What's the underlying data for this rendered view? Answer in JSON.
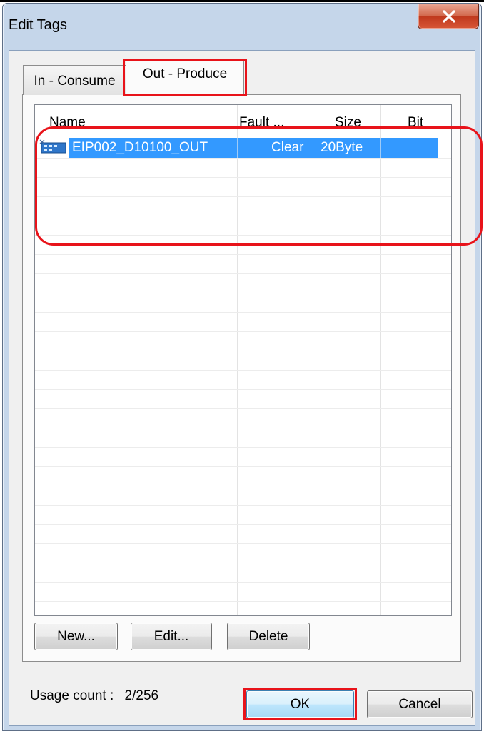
{
  "window": {
    "title": "Edit Tags",
    "close_glyph": "x"
  },
  "tabs": [
    {
      "label": "In - Consume",
      "active": false
    },
    {
      "label": "Out - Produce",
      "active": true
    }
  ],
  "list": {
    "columns": [
      "Name",
      "Fault ...",
      "Size",
      "Bit"
    ],
    "rows": [
      {
        "name": "EIP002_D10100_OUT",
        "fault": "Clear",
        "size": "20Byte",
        "bit": "",
        "selected": true,
        "icon": "tag-icon"
      }
    ]
  },
  "buttons": {
    "new": "New...",
    "edit": "Edit...",
    "delete": "Delete",
    "ok": "OK",
    "cancel": "Cancel"
  },
  "usage": {
    "label": "Usage count :",
    "value": "2/256"
  },
  "colors": {
    "selection": "#3399ff",
    "highlight": "#e8131a",
    "window_frame": "#c5d6ea"
  }
}
